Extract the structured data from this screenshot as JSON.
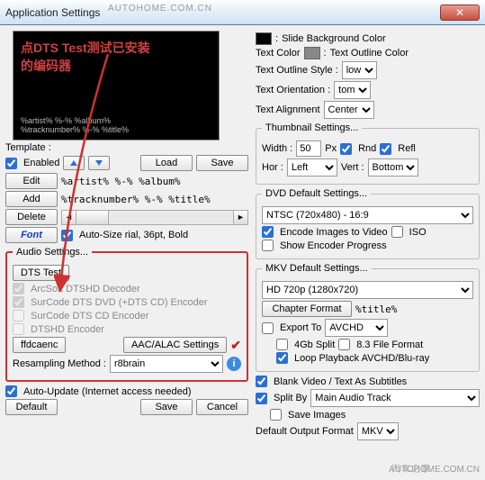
{
  "window": {
    "title": "Application Settings",
    "url_top": "AUTOHOME.COM.CN"
  },
  "preview": {
    "red1": "点DTS Test测试已安装",
    "red2": "的编码器",
    "g1": "%artist% %-% %album%",
    "g2": "%tracknumber% %-% %title%"
  },
  "template": {
    "label": "Template :",
    "enabled": "Enabled",
    "load": "Load",
    "save": "Save",
    "edit": "Edit",
    "add": "Add",
    "delete": "Delete",
    "font": "Font",
    "line1": "%artist% %-% %album%",
    "line2": "%tracknumber% %-% %title%",
    "autosize": "Auto-Size rial, 36pt, Bold"
  },
  "audio": {
    "legend": "Audio Settings...",
    "dts_test": "DTS Test",
    "opt1": "ArcSoft DTSHD Decoder",
    "opt2": "SurCode DTS DVD (+DTS CD) Encoder",
    "opt3": "SurCode DTS CD Encoder",
    "opt4": "DTSHD Encoder",
    "ffdcaenc": "ffdcaenc",
    "aac": "AAC/ALAC Settings",
    "resamp_label": "Resampling Method :",
    "resamp_val": "r8brain"
  },
  "autoupdate": "Auto-Update (Internet access needed)",
  "default": "Default",
  "save2": "Save",
  "cancel": "Cancel",
  "slide": {
    "bgcolor": "Slide Background Color",
    "textcolor": "Text Color",
    "outlinecolor": "Text Outline Color",
    "outlinestyle": "Text Outline Style :",
    "outlinestyle_val": "low",
    "orientation": "Text Orientation :",
    "orientation_val": "tom",
    "align": "Text Alignment",
    "align_val": "Center"
  },
  "thumb": {
    "legend": "Thumbnail Settings...",
    "width": "Width :",
    "width_val": "50",
    "px": "Px",
    "rnd": "Rnd",
    "refl": "Refl",
    "hor": "Hor :",
    "hor_val": "Left",
    "vert": "Vert :",
    "vert_val": "Bottom"
  },
  "dvd": {
    "legend": "DVD Default Settings...",
    "preset": "NTSC (720x480) - 16:9",
    "encode": "Encode Images to Video",
    "iso": "ISO",
    "show": "Show Encoder Progress"
  },
  "mkv": {
    "legend": "MKV Default Settings...",
    "preset": "HD 720p (1280x720)",
    "chapter": "Chapter Format",
    "chapter_val": "%title%",
    "export": "Export To",
    "export_val": "AVCHD",
    "split": "4Gb Split",
    "eight": "8.3 File Format",
    "loop": "Loop Playback AVCHD/Blu-ray"
  },
  "misc": {
    "blank": "Blank Video / Text As Subtitles",
    "splitby": "Split By",
    "splitby_val": "Main Audio Track",
    "saveimg": "Save Images",
    "defout": "Default Output Format",
    "defout_val": "MKV"
  },
  "watermark": "汽车之家",
  "watermark2": "AUTOHOME.COM.CN"
}
